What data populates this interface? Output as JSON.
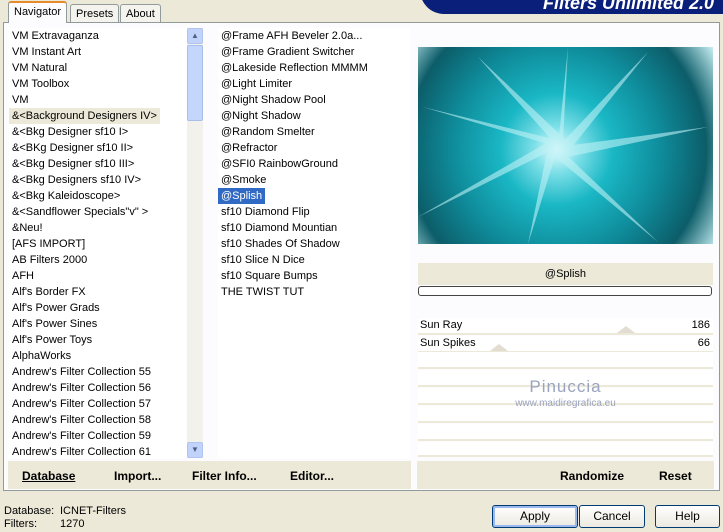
{
  "tabs": [
    "Navigator",
    "Presets",
    "About"
  ],
  "banner": "Filters Unlimited 2.0",
  "categories": [
    "VM Extravaganza",
    "VM Instant Art",
    "VM Natural",
    "VM Toolbox",
    "VM",
    "&<Background Designers IV>",
    "&<Bkg Designer sf10 I>",
    "&<BKg Designer sf10 II>",
    "&<Bkg Designer sf10 III>",
    "&<Bkg Designers sf10 IV>",
    "&<Bkg Kaleidoscope>",
    "&<Sandflower Specials\"v\" >",
    "&Neu!",
    "[AFS IMPORT]",
    "AB Filters 2000",
    "AFH",
    "Alf's Border FX",
    "Alf's Power Grads",
    "Alf's Power Sines",
    "Alf's Power Toys",
    "AlphaWorks",
    "Andrew's Filter Collection 55",
    "Andrew's Filter Collection 56",
    "Andrew's Filter Collection 57",
    "Andrew's Filter Collection 58",
    "Andrew's Filter Collection 59",
    "Andrew's Filter Collection 61"
  ],
  "selected_category_index": 5,
  "filters": [
    "@Frame AFH Beveler 2.0a...",
    "@Frame Gradient Switcher",
    "@Lakeside Reflection MMMM",
    "@Light Limiter",
    "@Night Shadow Pool",
    "@Night Shadow",
    "@Random Smelter",
    "@Refractor",
    "@SFI0 RainbowGround",
    "@Smoke",
    "@Splish",
    "sf10 Diamond Flip",
    "sf10 Diamond Mountian",
    "sf10 Shades Of Shadow",
    "sf10 Slice N Dice",
    "sf10 Square Bumps",
    "THE TWIST TUT"
  ],
  "selected_filter_index": 10,
  "filter_name": "@Splish",
  "progress": 0,
  "params": [
    {
      "label": "Sun Ray",
      "value": 186,
      "max": 255
    },
    {
      "label": "Sun Spikes",
      "value": 66,
      "max": 255
    }
  ],
  "watermark": {
    "name": "Pinuccia",
    "url": "www.maidiregrafica.eu"
  },
  "bottom_left": {
    "database": "Database",
    "import": "Import...",
    "filter_info": "Filter Info...",
    "editor": "Editor..."
  },
  "bottom_right": {
    "randomize": "Randomize",
    "reset": "Reset"
  },
  "status": {
    "db_label": "Database:",
    "db_value": "ICNET-Filters",
    "filters_label": "Filters:",
    "filters_value": "1270"
  },
  "buttons": {
    "apply": "Apply",
    "cancel": "Cancel",
    "help": "Help"
  }
}
